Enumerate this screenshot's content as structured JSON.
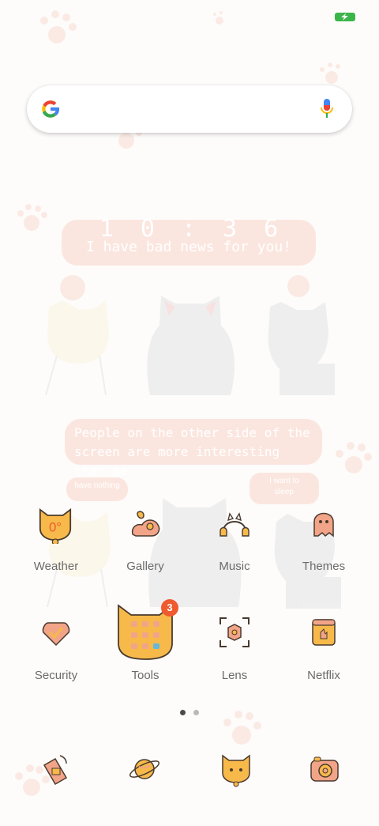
{
  "status_bar": {
    "battery_icon": "battery-charging-icon",
    "battery_color": "#3bb54a"
  },
  "search": {
    "logo_icon": "google-logo-icon",
    "mic_icon": "mic-icon"
  },
  "widget": {
    "clock_time": "10:36",
    "clock_message": "I have bad news for you!",
    "quote_line1": "People on the other side of the",
    "quote_line2": "screen are more interesting than me",
    "left_small": "have nothing",
    "right_small_line1": "I want to",
    "right_small_line2": "sleep"
  },
  "apps": [
    {
      "label": "Weather",
      "icon": "cat-bell-weather-icon",
      "temp": "0°"
    },
    {
      "label": "Gallery",
      "icon": "gallery-landscape-icon"
    },
    {
      "label": "Music",
      "icon": "headphones-cat-icon"
    },
    {
      "label": "Themes",
      "icon": "ghost-theme-icon"
    },
    {
      "label": "Security",
      "icon": "shield-check-icon"
    },
    {
      "label": "Tools",
      "icon": "cat-folder-icon",
      "badge": "3"
    },
    {
      "label": "Lens",
      "icon": "lens-scan-icon"
    },
    {
      "label": "Netflix",
      "icon": "netflix-card-icon"
    }
  ],
  "page_indicator": {
    "active_color": "#4a4a4a",
    "inactive_color": "#b9b9b9"
  },
  "dock": [
    {
      "icon": "phone-dock-icon"
    },
    {
      "icon": "planet-browser-icon"
    },
    {
      "icon": "cat-bell-icon"
    },
    {
      "icon": "camera-dock-icon"
    }
  ],
  "colors": {
    "accent": "#f7b94a",
    "outline": "#4a3a2e",
    "pink": "#f2a488",
    "label": "#6b6b6b"
  }
}
